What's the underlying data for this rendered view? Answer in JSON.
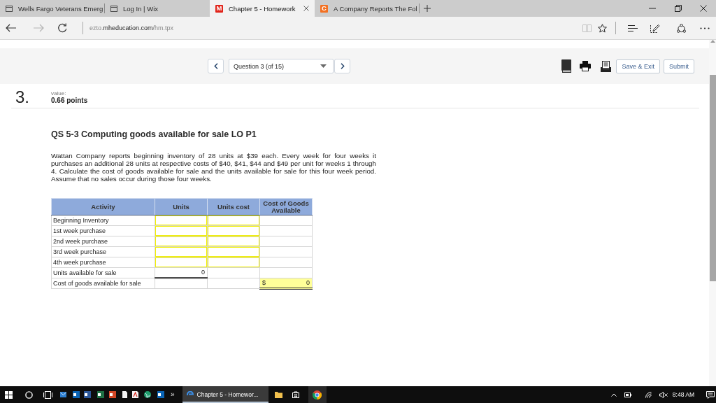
{
  "browser": {
    "tabs": [
      {
        "title": "Wells Fargo Veterans Emerg",
        "selected": false,
        "icon": {
          "kind": "page"
        }
      },
      {
        "title": "Log In | Wix",
        "selected": false,
        "icon": {
          "kind": "page"
        }
      },
      {
        "title": "Chapter 5 - Homework",
        "selected": true,
        "icon": {
          "kind": "letter",
          "letter": "M",
          "color": "#e1251b"
        }
      },
      {
        "title": "A Company Reports The Fol",
        "selected": false,
        "icon": {
          "kind": "letter",
          "letter": "C",
          "color": "#f37021"
        }
      }
    ],
    "forward": {
      "disabled": true
    },
    "address": "ezto.**mheducation.com**/hm.tpx",
    "reading_view": {
      "disabled": true
    }
  },
  "toolbar": {
    "question_select": "Question 3 (of 15)",
    "buttons": [
      "Save & Exit",
      "Submit"
    ]
  },
  "question": {
    "number": "3.",
    "value_label": "value:",
    "points": "0.66 points",
    "title": "QS 5-3 Computing goods available for sale LO P1",
    "text": "Wattan Company reports beginning inventory of 28 units at $39 each. Every week for four weeks it purchases an additional 28 units at respective costs of $40, $41, $44 and $49 per unit for weeks 1 through 4. Calculate the cost of goods available for sale and the units available for sale for this four week period. Assume that no sales occur during those four weeks."
  },
  "table": {
    "columns": [
      "Activity",
      "Units",
      "Units cost",
      "Cost of Goods Available"
    ],
    "rows": [
      {
        "cells": [
          {
            "kind": "text",
            "text": "Beginning Inventory"
          },
          {
            "kind": "input"
          },
          {
            "kind": "input"
          },
          {
            "kind": "empty"
          }
        ]
      },
      {
        "cells": [
          {
            "kind": "text",
            "text": "1st week purchase"
          },
          {
            "kind": "input"
          },
          {
            "kind": "input"
          },
          {
            "kind": "empty"
          }
        ]
      },
      {
        "cells": [
          {
            "kind": "text",
            "text": "2nd week purchase"
          },
          {
            "kind": "input"
          },
          {
            "kind": "input"
          },
          {
            "kind": "empty"
          }
        ]
      },
      {
        "cells": [
          {
            "kind": "text",
            "text": "3rd week purchase"
          },
          {
            "kind": "input"
          },
          {
            "kind": "input"
          },
          {
            "kind": "empty"
          }
        ]
      },
      {
        "cells": [
          {
            "kind": "text",
            "text": "4th week purchase"
          },
          {
            "kind": "input"
          },
          {
            "kind": "input"
          },
          {
            "kind": "empty"
          }
        ]
      },
      {
        "cells": [
          {
            "kind": "text",
            "text": "Units available for sale"
          },
          {
            "kind": "total",
            "text": "0"
          },
          {
            "kind": "empty"
          },
          {
            "kind": "empty"
          }
        ]
      },
      {
        "cells": [
          {
            "kind": "text",
            "text": "Cost of goods available for sale"
          },
          {
            "kind": "empty"
          },
          {
            "kind": "empty"
          },
          {
            "kind": "grand_total",
            "currency": "$",
            "text": "0"
          }
        ]
      }
    ]
  },
  "taskbar": {
    "overflow": "»",
    "window": {
      "label": "Chapter 5 - Homewor...",
      "selected": true
    },
    "clock": "8:48 AM"
  }
}
